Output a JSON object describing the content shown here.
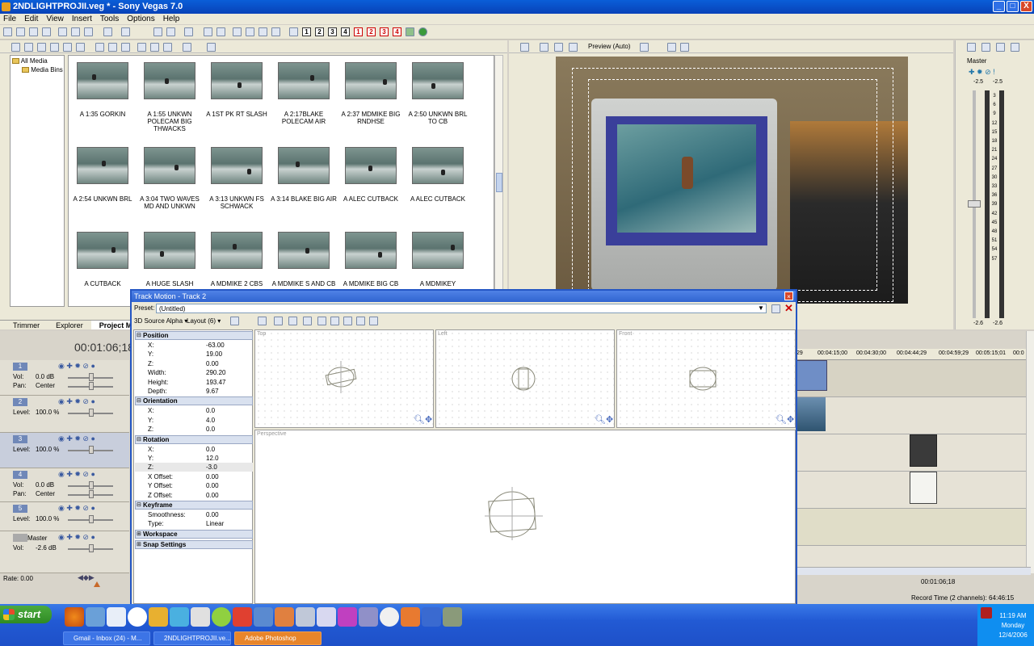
{
  "window": {
    "title": "2NDLIGHTPROJII.veg * - Sony Vegas 7.0",
    "buttons": [
      "_",
      "□",
      "X"
    ]
  },
  "menu": [
    "File",
    "Edit",
    "View",
    "Insert",
    "Tools",
    "Options",
    "Help"
  ],
  "toolbar": {
    "track_numbers": [
      "1",
      "2",
      "3",
      "4"
    ],
    "track_numbers_red": [
      "1",
      "2",
      "3",
      "4"
    ]
  },
  "media": {
    "tree": [
      "All Media",
      "Media Bins"
    ],
    "clips": [
      "A 1:35 GORKIN",
      "A 1:55 UNKWN POLECAM BIG THWACKS",
      "A 1ST PK RT SLASH",
      "A 2:17BLAKE POLECAM AIR",
      "A 2:37 MDMIKE BIG RNDHSE",
      "A 2:50 UNKWN BRL TO CB",
      "A 2:54 UNKWN BRL",
      "A 3:04 TWO WAVES MD AND UNKWN",
      "A 3:13 UNKWN FS SCHWACK",
      "A 3:14 BLAKE BIG AIR",
      "A ALEC CUTBACK",
      "A ALEC CUTBACK",
      "A CUTBACK",
      "A HUGE SLASH",
      "A MDMIKE 2 CBS",
      "A MDMIKE S AND CB",
      "A MDMIKE BIG CB",
      "A MDMIKEY"
    ],
    "tabs": [
      "Trimmer",
      "Explorer",
      "Project Media"
    ]
  },
  "preview": {
    "mode": "Preview (Auto)"
  },
  "master": {
    "label": "Master",
    "top_values": [
      "-2.5",
      "-2.5"
    ],
    "scale": [
      "3",
      "6",
      "9",
      "12",
      "15",
      "18",
      "21",
      "24",
      "27",
      "30",
      "33",
      "36",
      "39",
      "42",
      "45",
      "48",
      "51",
      "54",
      "57"
    ],
    "bottom_values": [
      "-2.6",
      "-2.6"
    ]
  },
  "timeline": {
    "timecode": "00:01:06;18",
    "ruler": [
      "29",
      "00:04:15;00",
      "00:04:30;00",
      "00:04:44;29",
      "00:04:59;29",
      "00:05:15;01",
      "00:0"
    ],
    "cursor_time": "00:01:06;18",
    "record_time": "Record Time (2 channels): 64:46:15",
    "rate": "Rate: 0.00",
    "tracks": [
      {
        "num": "1",
        "lines": [
          [
            "Vol:",
            "0.0 dB"
          ],
          [
            "Pan:",
            "Center"
          ]
        ]
      },
      {
        "num": "2",
        "lines": [
          [
            "Level:",
            "100.0 %"
          ]
        ]
      },
      {
        "num": "3",
        "lines": [
          [
            "Level:",
            "100.0 %"
          ]
        ]
      },
      {
        "num": "4",
        "lines": [
          [
            "Vol:",
            "0.0 dB"
          ],
          [
            "Pan:",
            "Center"
          ]
        ]
      },
      {
        "num": "5",
        "lines": [
          [
            "Level:",
            "100.0 %"
          ]
        ]
      },
      {
        "num": "",
        "name": "Master",
        "lines": [
          [
            "Vol:",
            "-2.6 dB"
          ]
        ]
      }
    ]
  },
  "track_motion": {
    "title": "Track Motion - Track 2",
    "preset_label": "Preset:",
    "preset_value": "(Untitled)",
    "source_alpha": "3D Source Alpha",
    "layout": "Layout (6)",
    "sections": {
      "position": {
        "title": "Position",
        "rows": [
          [
            "X:",
            "-63.00"
          ],
          [
            "Y:",
            "19.00"
          ],
          [
            "Z:",
            "0.00"
          ],
          [
            "Width:",
            "290.20"
          ],
          [
            "Height:",
            "193.47"
          ],
          [
            "Depth:",
            "9.67"
          ]
        ]
      },
      "orientation": {
        "title": "Orientation",
        "rows": [
          [
            "X:",
            "0.0"
          ],
          [
            "Y:",
            "4.0"
          ],
          [
            "Z:",
            "0.0"
          ]
        ]
      },
      "rotation": {
        "title": "Rotation",
        "rows": [
          [
            "X:",
            "0.0"
          ],
          [
            "Y:",
            "12.0"
          ],
          [
            "Z:",
            "-3.0"
          ],
          [
            "X Offset:",
            "0.00"
          ],
          [
            "Y Offset:",
            "0.00"
          ],
          [
            "Z Offset:",
            "0.00"
          ]
        ]
      },
      "keyframe": {
        "title": "Keyframe",
        "rows": [
          [
            "Smoothness:",
            "0.00"
          ],
          [
            "Type:",
            "Linear"
          ]
        ]
      },
      "workspace": {
        "title": "Workspace"
      },
      "snap": {
        "title": "Snap Settings"
      }
    },
    "views": [
      "Top",
      "Left",
      "Front",
      "Perspective"
    ]
  },
  "taskbar": {
    "start": "start",
    "buttons": [
      "Gmail - Inbox (24) - M...",
      "2NDLIGHTPROJII.ve...",
      "Adobe Photoshop"
    ],
    "clock": {
      "time": "11:19 AM",
      "day": "Monday",
      "date": "12/4/2006"
    }
  }
}
